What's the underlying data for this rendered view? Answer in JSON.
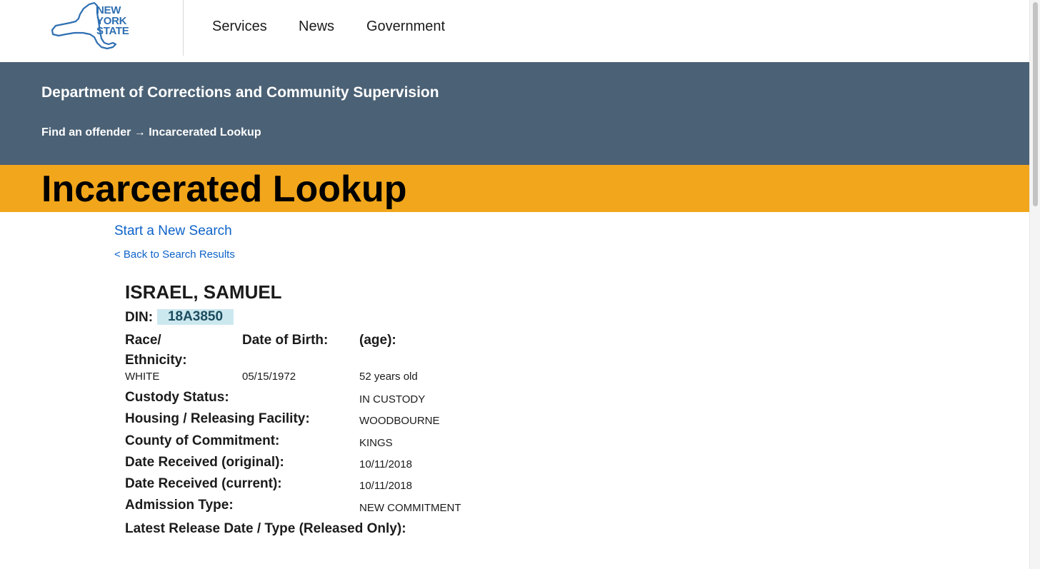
{
  "header": {
    "logo": {
      "line1": "NEW",
      "line2": "YORK",
      "line3": "STATE"
    },
    "nav": [
      "Services",
      "News",
      "Government"
    ]
  },
  "agency": {
    "title": "Department of Corrections and Community Supervision",
    "breadcrumb": "Find an offender → Incarcerated Lookup"
  },
  "page_title": "Incarcerated Lookup",
  "links": {
    "new_search": "Start a New Search",
    "back": "< Back to Search Results"
  },
  "record": {
    "name": "ISRAEL, SAMUEL",
    "din_label": "DIN:",
    "din": "18A3850",
    "race_label_1": "Race/",
    "race_label_2": "Ethnicity:",
    "race": "WHITE",
    "dob_label": "Date of Birth:",
    "dob": "05/15/1972",
    "age_label": "(age):",
    "age": "52 years old",
    "custody_label": "Custody Status:",
    "custody": "IN CUSTODY",
    "facility_label": "Housing / Releasing Facility:",
    "facility": "WOODBOURNE",
    "county_label": "County of Commitment:",
    "county": "KINGS",
    "received_original_label": "Date Received (original):",
    "received_original": "10/11/2018",
    "received_current_label": "Date Received (current):",
    "received_current": "10/11/2018",
    "admission_label": "Admission Type:",
    "admission": "NEW COMMITMENT",
    "release_label": "Latest Release Date / Type (Released Only):"
  },
  "colors": {
    "agency_band": "#4b6175",
    "title_band": "#f2a61b",
    "link": "#0d63c9",
    "din_highlight": "#cce8ef",
    "logo": "#2e6fb2"
  }
}
